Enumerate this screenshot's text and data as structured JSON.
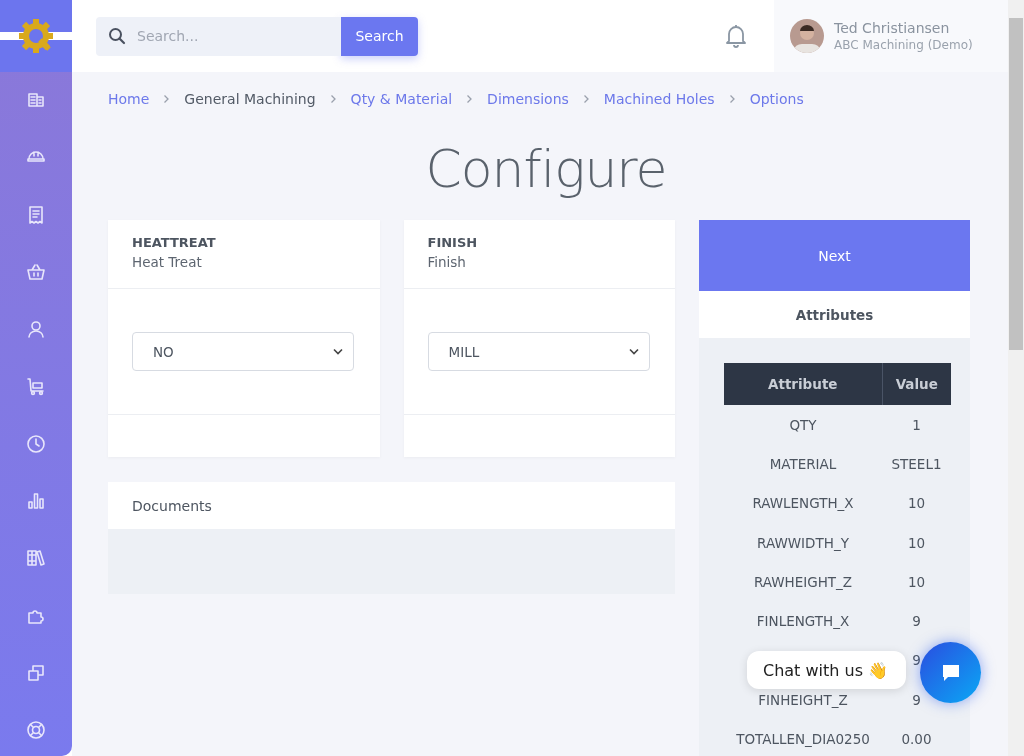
{
  "search": {
    "placeholder": "Search...",
    "button": "Search"
  },
  "user": {
    "name": "Ted Christiansen",
    "company": "ABC Machining (Demo)"
  },
  "breadcrumbs": [
    {
      "label": "Home",
      "link": true
    },
    {
      "label": "General Machining",
      "link": false
    },
    {
      "label": "Qty & Material",
      "link": true
    },
    {
      "label": "Dimensions",
      "link": true
    },
    {
      "label": "Machined Holes",
      "link": true
    },
    {
      "label": "Options",
      "link": true
    }
  ],
  "title": "Configure",
  "options": [
    {
      "code": "HEATTREAT",
      "name": "Heat Treat",
      "value": "NO"
    },
    {
      "code": "FINISH",
      "name": "Finish",
      "value": "MILL"
    }
  ],
  "documents": {
    "title": "Documents"
  },
  "next_button": "Next",
  "attributes": {
    "title": "Attributes",
    "columns": [
      "Attribute",
      "Value"
    ],
    "rows": [
      {
        "attribute": "QTY",
        "value": "1"
      },
      {
        "attribute": "MATERIAL",
        "value": "STEEL1"
      },
      {
        "attribute": "RAWLENGTH_X",
        "value": "10"
      },
      {
        "attribute": "RAWWIDTH_Y",
        "value": "10"
      },
      {
        "attribute": "RAWHEIGHT_Z",
        "value": "10"
      },
      {
        "attribute": "FINLENGTH_X",
        "value": "9"
      },
      {
        "value": "9"
      },
      {
        "attribute": "FINHEIGHT_Z",
        "value": "9"
      },
      {
        "attribute": "TOTALLEN_DIA0250",
        "value": "0.00"
      }
    ]
  },
  "chat": {
    "label": "Chat with us 👋"
  }
}
